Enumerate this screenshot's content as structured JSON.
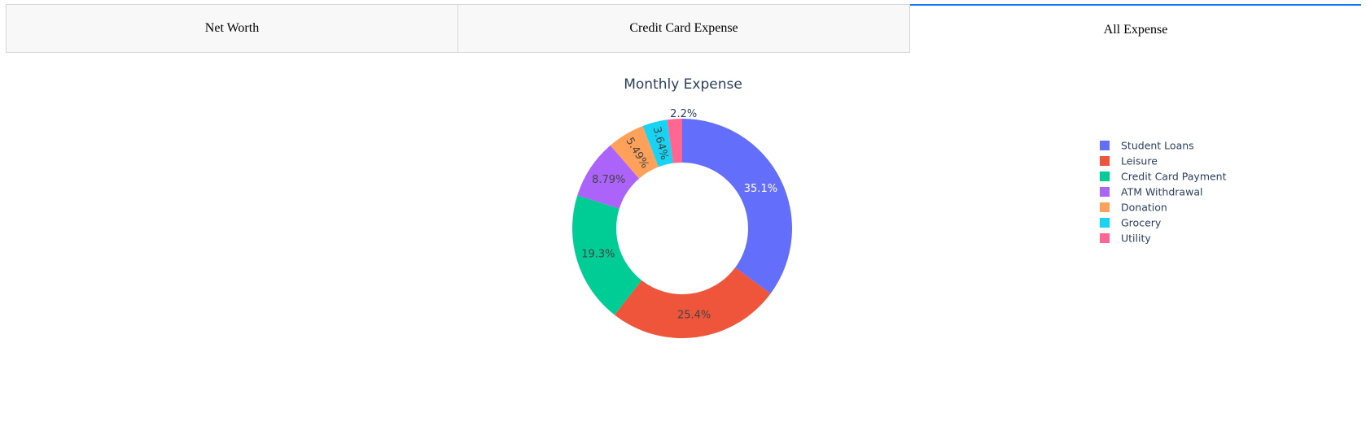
{
  "tabs": [
    {
      "label": "Net Worth",
      "active": false
    },
    {
      "label": "Credit Card Expense",
      "active": false
    },
    {
      "label": "All Expense",
      "active": true
    }
  ],
  "colors": {
    "tab_active_accent": "#1975fa",
    "title": "#2a3f5f",
    "label_dark": "#2a3f5f",
    "label_light": "#ffffff"
  },
  "chart_data": {
    "type": "pie",
    "hole": true,
    "title": "Monthly Expense",
    "legend_position": "top-right",
    "categories": [
      "Student Loans",
      "Leisure",
      "Credit Card Payment",
      "ATM Withdrawal",
      "Donation",
      "Grocery",
      "Utility"
    ],
    "values": [
      35.1,
      25.4,
      19.3,
      8.79,
      5.49,
      3.64,
      2.2
    ],
    "labels": [
      "35.1%",
      "25.4%",
      "19.3%",
      "8.79%",
      "5.49%",
      "3.64%",
      "2.2%"
    ],
    "colors": [
      "#636efa",
      "#EF553B",
      "#00cc96",
      "#ab63fa",
      "#FFA15A",
      "#19d3f3",
      "#FF6692"
    ]
  }
}
